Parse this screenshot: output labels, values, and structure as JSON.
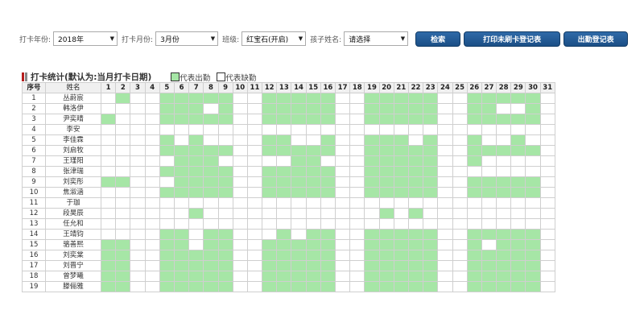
{
  "filters": {
    "year_label": "打卡年份:",
    "year_value": "2018年",
    "month_label": "打卡月份:",
    "month_value": "3月份",
    "class_label": "班级:",
    "class_value": "红宝石(开启)",
    "child_label": "孩子姓名:",
    "child_value": "请选择"
  },
  "buttons": {
    "search": "检索",
    "print_missing": "打印未刷卡登记表",
    "attendance": "出勤登记表"
  },
  "section": {
    "title": "打卡统计(默认为:当月打卡日期)",
    "legend_present": "代表出勤",
    "legend_absent": "代表缺勤",
    "present_color": "#a6e6a6",
    "accent_color": "#b51d1d"
  },
  "table": {
    "header_no": "序号",
    "header_name": "姓名",
    "days": [
      "1",
      "2",
      "3",
      "4",
      "5",
      "6",
      "7",
      "8",
      "9",
      "10",
      "11",
      "12",
      "13",
      "14",
      "15",
      "16",
      "17",
      "18",
      "19",
      "20",
      "21",
      "22",
      "23",
      "24",
      "25",
      "26",
      "27",
      "28",
      "29",
      "30",
      "31"
    ],
    "rows": [
      {
        "no": "1",
        "name": "丛蔚宸",
        "present": [
          2,
          5,
          6,
          7,
          8,
          9,
          12,
          13,
          14,
          15,
          16,
          19,
          20,
          21,
          22,
          23,
          26,
          27,
          28,
          29,
          30
        ]
      },
      {
        "no": "2",
        "name": "韩洛伊",
        "present": [
          5,
          6,
          7,
          9,
          12,
          13,
          14,
          15,
          16,
          19,
          20,
          21,
          22,
          23,
          26,
          27,
          30
        ]
      },
      {
        "no": "3",
        "name": "尹奕晴",
        "present": [
          1,
          5,
          6,
          7,
          8,
          9,
          12,
          13,
          14,
          15,
          16,
          19,
          20,
          21,
          22,
          23,
          26,
          27,
          28,
          29,
          30
        ]
      },
      {
        "no": "4",
        "name": "李安",
        "present": []
      },
      {
        "no": "5",
        "name": "李佳霖",
        "present": [
          5,
          7,
          12,
          13,
          16,
          19,
          20,
          21,
          23,
          26,
          29
        ]
      },
      {
        "no": "6",
        "name": "刘启牧",
        "present": [
          5,
          6,
          7,
          8,
          9,
          12,
          13,
          14,
          15,
          16,
          19,
          20,
          21,
          22,
          23,
          26,
          27,
          28,
          29,
          30
        ]
      },
      {
        "no": "7",
        "name": "王瑾阳",
        "present": [
          6,
          7,
          8,
          14,
          15,
          19,
          20,
          21,
          22,
          23,
          26
        ]
      },
      {
        "no": "8",
        "name": "张津瑞",
        "present": [
          5,
          6,
          7,
          8,
          9,
          12,
          13,
          14,
          15,
          16,
          19,
          20,
          21,
          22,
          23
        ]
      },
      {
        "no": "9",
        "name": "刘奕彤",
        "present": [
          1,
          2,
          6,
          7,
          8,
          9,
          12,
          13,
          14,
          15,
          16,
          19,
          20,
          21,
          22,
          23,
          26,
          27,
          28,
          29,
          30
        ]
      },
      {
        "no": "10",
        "name": "焦溆涵",
        "present": [
          5,
          6,
          7,
          8,
          9,
          12,
          13,
          14,
          15,
          16,
          19,
          20,
          21,
          22,
          23,
          26,
          27,
          28,
          29,
          30
        ]
      },
      {
        "no": "11",
        "name": "于珈",
        "present": []
      },
      {
        "no": "12",
        "name": "段昊辰",
        "present": [
          7,
          20,
          22
        ]
      },
      {
        "no": "13",
        "name": "任允和",
        "present": []
      },
      {
        "no": "14",
        "name": "王靖钧",
        "present": [
          5,
          6,
          8,
          9,
          13,
          15,
          16,
          19,
          20,
          21,
          22,
          23,
          26,
          27,
          28,
          29,
          30
        ]
      },
      {
        "no": "15",
        "name": "骆善熙",
        "present": [
          1,
          2,
          5,
          6,
          8,
          9,
          12,
          13,
          14,
          15,
          16,
          19,
          20,
          21,
          22,
          23,
          26,
          28,
          29,
          30
        ]
      },
      {
        "no": "16",
        "name": "刘奕棠",
        "present": [
          1,
          2,
          5,
          6,
          7,
          8,
          9,
          12,
          13,
          14,
          15,
          16,
          19,
          20,
          21,
          22,
          23,
          26,
          27,
          28,
          29,
          30
        ]
      },
      {
        "no": "17",
        "name": "刘晋宁",
        "present": [
          1,
          2,
          5,
          6,
          7,
          8,
          9,
          12,
          13,
          14,
          15,
          16,
          19,
          20,
          21,
          22,
          23,
          26,
          27,
          28,
          29,
          30
        ]
      },
      {
        "no": "18",
        "name": "曾梦曦",
        "present": [
          1,
          2,
          5,
          6,
          7,
          8,
          9,
          12,
          13,
          14,
          15,
          16,
          19,
          20,
          21,
          22,
          23,
          26,
          27,
          28,
          29,
          30
        ]
      },
      {
        "no": "19",
        "name": "滕俪雅",
        "present": [
          1,
          2,
          5,
          6,
          7,
          8,
          9,
          12,
          13,
          14,
          15,
          16,
          19,
          20,
          21,
          22,
          23,
          26,
          27,
          28,
          29,
          30
        ]
      }
    ]
  }
}
